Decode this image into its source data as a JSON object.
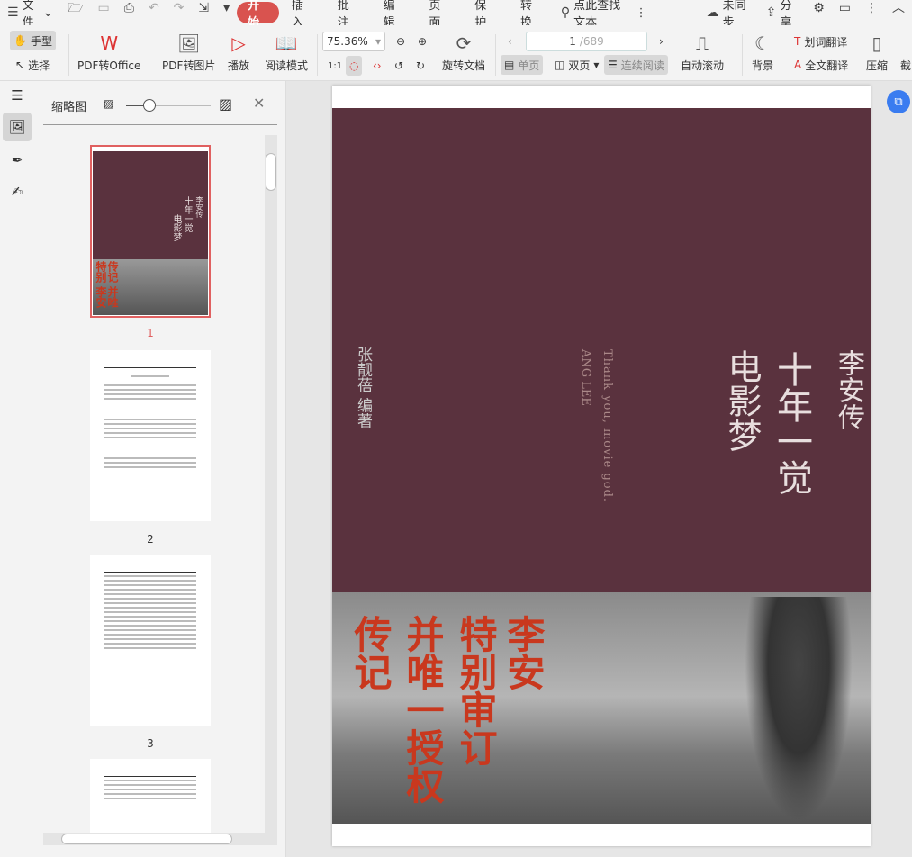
{
  "topbar": {
    "menu": "文件",
    "tabs": [
      "开始",
      "插入",
      "批注",
      "编辑",
      "页面",
      "保护",
      "转换"
    ],
    "search": "点此查找文本",
    "sync": "未同步",
    "share": "分享"
  },
  "toolbar": {
    "hand": "手型",
    "select": "选择",
    "pdf_office": "PDF转Office",
    "pdf_image": "PDF转图片",
    "play": "播放",
    "read_mode": "阅读模式",
    "zoom": "75.36%",
    "rotate": "旋转文档",
    "page_current": "1",
    "page_total": "/689",
    "single": "单页",
    "double": "双页",
    "continuous": "连续阅读",
    "auto_scroll": "自动滚动",
    "background": "背景",
    "word_translate": "划词翻译",
    "full_translate": "全文翻译",
    "compress": "压缩",
    "crop": "截"
  },
  "panel": {
    "title": "缩略图",
    "thumbnails": [
      {
        "num": "1"
      },
      {
        "num": "2"
      },
      {
        "num": "3"
      }
    ]
  },
  "cover": {
    "series": "李安传",
    "title1": "十年一觉",
    "title2": "电影梦",
    "english": "Thank you, movie god.",
    "english2": "ANG LEE",
    "author": "张靓蓓 编著",
    "red_cols": [
      "李安",
      "特别审订",
      "并唯一授权",
      "传记"
    ]
  }
}
